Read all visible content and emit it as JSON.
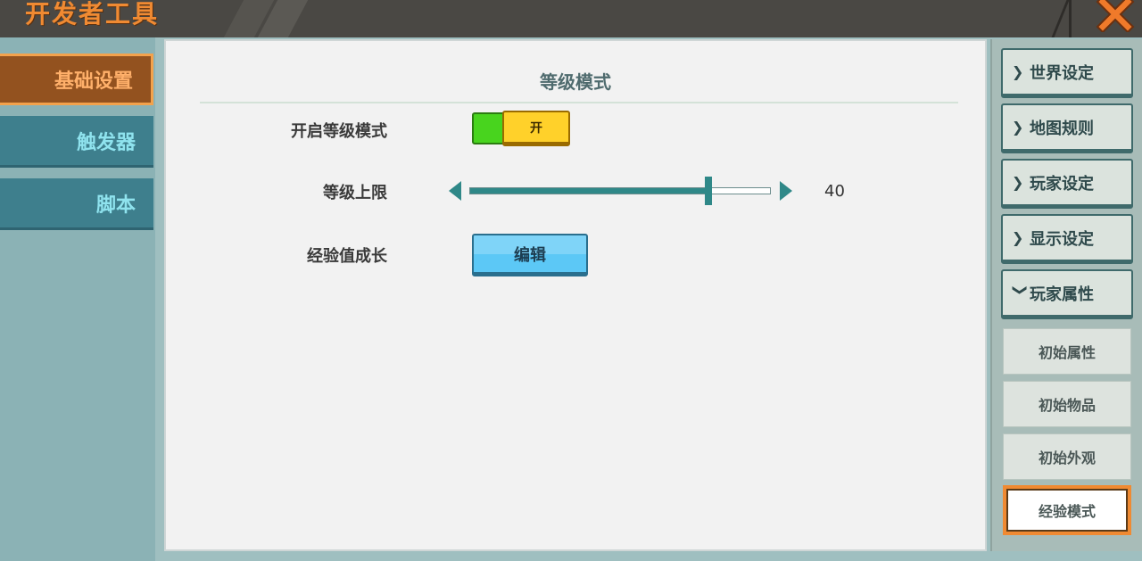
{
  "window": {
    "title": "开发者工具"
  },
  "sidebar": {
    "tabs": [
      {
        "label": "基础设置",
        "active": true
      },
      {
        "label": "触发器",
        "active": false
      },
      {
        "label": "脚本",
        "active": false
      }
    ]
  },
  "main": {
    "section_title": "等级模式",
    "rows": {
      "level_mode": {
        "label": "开启等级模式",
        "toggle_text": "开",
        "toggle_on": true
      },
      "level_cap": {
        "label": "等级上限",
        "value": "40",
        "slider_fraction": 0.8
      },
      "exp_growth": {
        "label": "经验值成长",
        "button_label": "编辑"
      }
    }
  },
  "rightnav": {
    "categories": [
      {
        "label": "世界设定",
        "icon": "chevron-right-icon"
      },
      {
        "label": "地图规则",
        "icon": "chevron-right-icon"
      },
      {
        "label": "玩家设定",
        "icon": "chevron-right-icon"
      },
      {
        "label": "显示设定",
        "icon": "chevron-right-icon"
      },
      {
        "label": "玩家属性",
        "icon": "chevron-down-icon"
      }
    ],
    "subitems": [
      {
        "label": "初始属性",
        "active": false
      },
      {
        "label": "初始物品",
        "active": false
      },
      {
        "label": "初始外观",
        "active": false
      },
      {
        "label": "经验模式",
        "active": true
      }
    ]
  },
  "colors": {
    "accent_orange": "#f08a32",
    "teal": "#2f8888",
    "toggle_green": "#48d41e",
    "toggle_yellow": "#ffd12a",
    "button_blue": "#5cc8f6"
  }
}
